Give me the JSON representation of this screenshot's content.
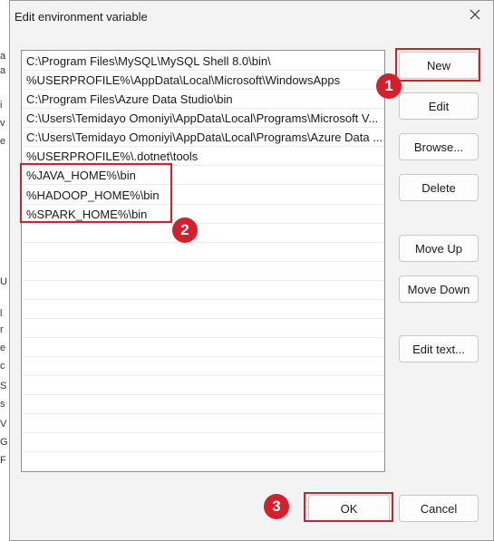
{
  "dialog": {
    "title": "Edit environment variable"
  },
  "paths": [
    "C:\\Program Files\\MySQL\\MySQL Shell 8.0\\bin\\",
    "%USERPROFILE%\\AppData\\Local\\Microsoft\\WindowsApps",
    "C:\\Program Files\\Azure Data Studio\\bin",
    "C:\\Users\\Temidayo Omoniyi\\AppData\\Local\\Programs\\Microsoft V...",
    "C:\\Users\\Temidayo Omoniyi\\AppData\\Local\\Programs\\Azure Data ...",
    "%USERPROFILE%\\.dotnet\\tools",
    "%JAVA_HOME%\\bin",
    "%HADOOP_HOME%\\bin",
    "%SPARK_HOME%\\bin"
  ],
  "buttons": {
    "new": "New",
    "edit": "Edit",
    "browse": "Browse...",
    "delete": "Delete",
    "move_up": "Move Up",
    "move_down": "Move Down",
    "edit_text": "Edit text...",
    "ok": "OK",
    "cancel": "Cancel"
  },
  "markers": {
    "one": "1",
    "two": "2",
    "three": "3"
  },
  "background_letters": [
    "a",
    "a",
    "i",
    "v",
    "e",
    "U",
    "l",
    "r",
    "e",
    "c",
    "S",
    "s",
    "V",
    "G",
    "F"
  ],
  "colors": {
    "highlight": "#d61f2a",
    "dialog_bg": "#f3f3f3",
    "list_bg": "#ffffff"
  },
  "icons": {
    "close": "close-icon"
  }
}
